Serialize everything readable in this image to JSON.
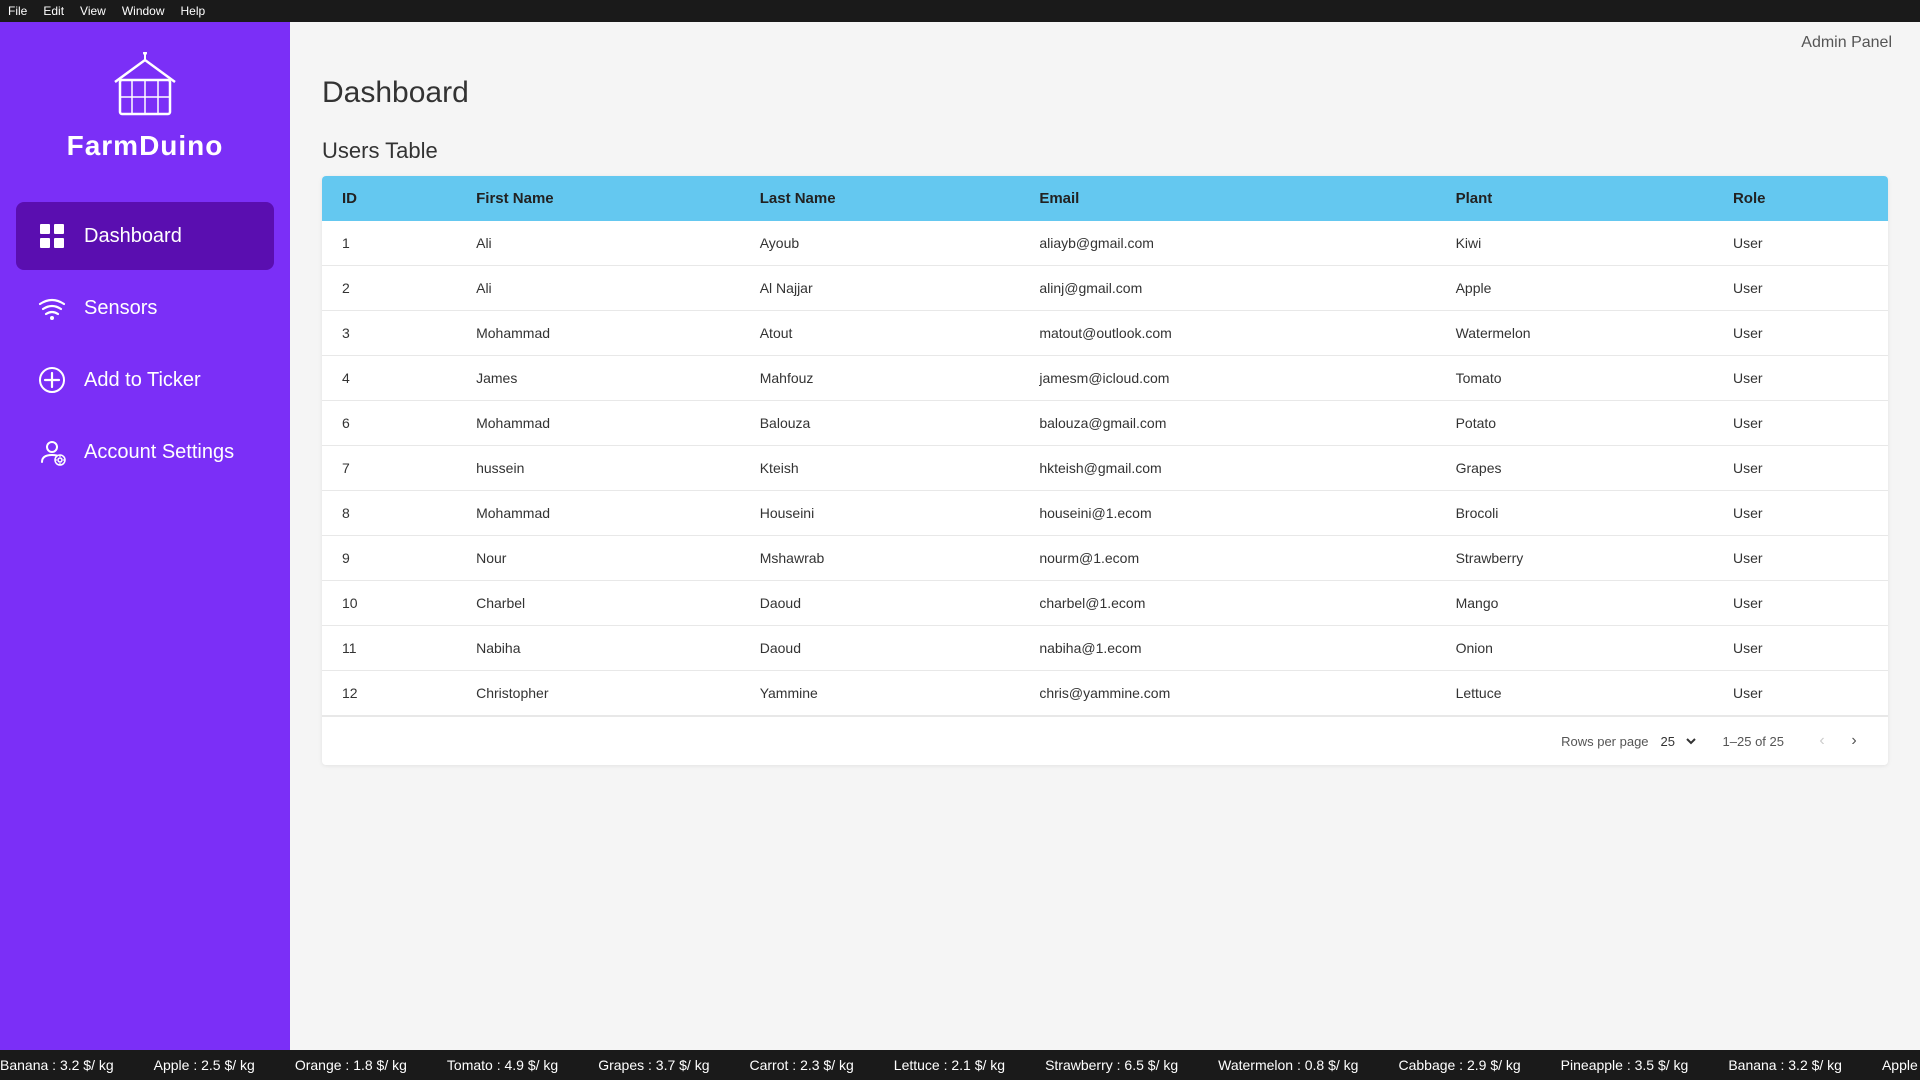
{
  "menubar": {
    "items": [
      "File",
      "Edit",
      "View",
      "Window",
      "Help"
    ]
  },
  "sidebar": {
    "logo_text": "FarmDuino",
    "nav_items": [
      {
        "id": "dashboard",
        "label": "Dashboard",
        "icon": "grid-icon",
        "active": true
      },
      {
        "id": "sensors",
        "label": "Sensors",
        "icon": "wifi-icon",
        "active": false
      },
      {
        "id": "add-to-ticker",
        "label": "Add to Ticker",
        "icon": "add-icon",
        "active": false
      },
      {
        "id": "account-settings",
        "label": "Account Settings",
        "icon": "user-icon",
        "active": false
      }
    ]
  },
  "header": {
    "admin_label": "Admin Panel"
  },
  "page": {
    "title": "Dashboard",
    "table_title": "Users Table"
  },
  "table": {
    "columns": [
      "ID",
      "First Name",
      "Last Name",
      "Email",
      "Plant",
      "Role"
    ],
    "rows": [
      {
        "id": "1",
        "first": "Ali",
        "last": "Ayoub",
        "email": "aliayb@gmail.com",
        "plant": "Kiwi",
        "role": "User"
      },
      {
        "id": "2",
        "first": "Ali",
        "last": "Al Najjar",
        "email": "alinj@gmail.com",
        "plant": "Apple",
        "role": "User"
      },
      {
        "id": "3",
        "first": "Mohammad",
        "last": "Atout",
        "email": "matout@outlook.com",
        "plant": "Watermelon",
        "role": "User"
      },
      {
        "id": "4",
        "first": "James",
        "last": "Mahfouz",
        "email": "jamesm@icloud.com",
        "plant": "Tomato",
        "role": "User"
      },
      {
        "id": "6",
        "first": "Mohammad",
        "last": "Balouza",
        "email": "balouza@gmail.com",
        "plant": "Potato",
        "role": "User"
      },
      {
        "id": "7",
        "first": "hussein",
        "last": "Kteish",
        "email": "hkteish@gmail.com",
        "plant": "Grapes",
        "role": "User"
      },
      {
        "id": "8",
        "first": "Mohammad",
        "last": "Houseini",
        "email": "houseini@1.ecom",
        "plant": "Brocoli",
        "role": "User"
      },
      {
        "id": "9",
        "first": "Nour",
        "last": "Mshawrab",
        "email": "nourm@1.ecom",
        "plant": "Strawberry",
        "role": "User"
      },
      {
        "id": "10",
        "first": "Charbel",
        "last": "Daoud",
        "email": "charbel@1.ecom",
        "plant": "Mango",
        "role": "User"
      },
      {
        "id": "11",
        "first": "Nabiha",
        "last": "Daoud",
        "email": "nabiha@1.ecom",
        "plant": "Onion",
        "role": "User"
      },
      {
        "id": "12",
        "first": "Christopher",
        "last": "Yammine",
        "email": "chris@yammine.com",
        "plant": "Lettuce",
        "role": "User"
      }
    ],
    "footer": {
      "rows_per_page_label": "Rows per page",
      "rows_per_page_value": "25",
      "pagination_info": "1–25 of 25"
    }
  },
  "ticker": {
    "items": [
      "Banana : 3.2 $/ kg",
      "Apple : 2.5 $/ kg",
      "Orange : 1.8 $/ kg",
      "Tomato : 4.9 $/ kg",
      "Grapes : 3.7 $/ kg",
      "Carrot : 2.3 $/ kg",
      "Lettuce : 2.1 $/ kg",
      "Strawberry : 6.5 $/ kg",
      "Watermelon : 0.8 $/ kg",
      "Cabbage : 2.9 $/ kg",
      "Pineapple : 3.5 $/ kg"
    ]
  }
}
